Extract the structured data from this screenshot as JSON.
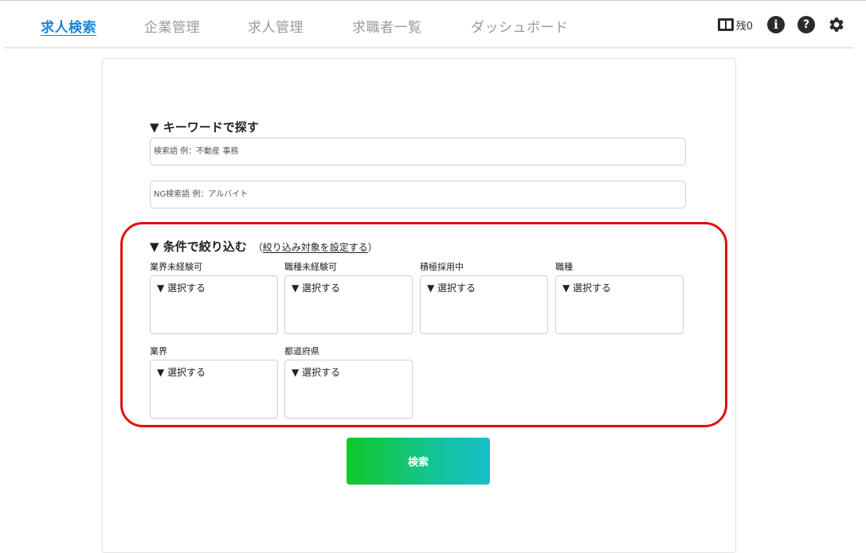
{
  "nav": {
    "items": [
      "求人検索",
      "企業管理",
      "求人管理",
      "求職者一覧",
      "ダッシュボード"
    ],
    "remaining_label": "残0"
  },
  "keyword_section": {
    "title": "▼ キーワードで探す",
    "keyword_placeholder": "検索語 例：不動産 事務",
    "ng_placeholder": "NG検索語 例：アルバイト"
  },
  "filter_section": {
    "title": "▼ 条件で絞り込む",
    "link_open": "（",
    "link_text": "絞り込み対象を設定する",
    "link_close": "）",
    "filters": [
      {
        "label": "業界未経験可",
        "value": "▼ 選択する"
      },
      {
        "label": "職種未経験可",
        "value": "▼ 選択する"
      },
      {
        "label": "積極採用中",
        "value": "▼ 選択する"
      },
      {
        "label": "職種",
        "value": "▼ 選択する"
      },
      {
        "label": "業界",
        "value": "▼ 選択する"
      },
      {
        "label": "都道府県",
        "value": "▼ 選択する"
      }
    ]
  },
  "search_button_label": "検索",
  "colors": {
    "active_nav": "#1a86d8",
    "highlight": "#e01010",
    "button_start": "#10c928",
    "button_end": "#18c0c8"
  }
}
